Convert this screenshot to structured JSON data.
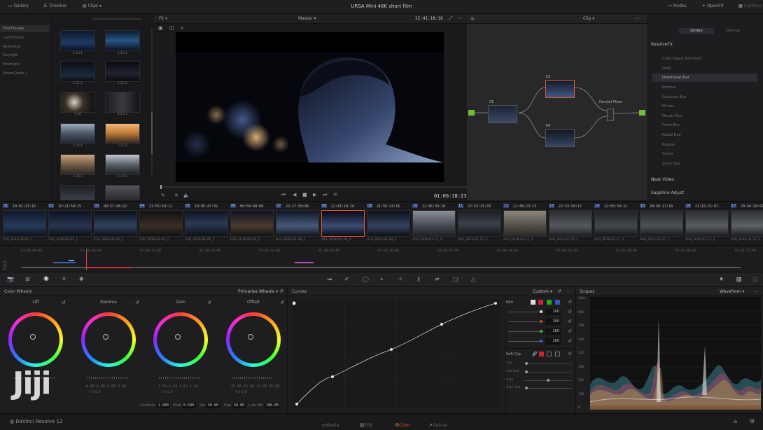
{
  "topbar": {
    "gallery": "Gallery",
    "timeline": "Timeline",
    "clips": "Clips",
    "title": "URSA Mini 46K short film",
    "nodes": "Nodes",
    "openfx": "OpenFX",
    "lightbox": "Lightbox"
  },
  "gallery": {
    "albums": [
      "First Frames",
      "Last Frames",
      "Reference",
      "Daylight",
      "Moonlight",
      "PowerGrade 1"
    ],
    "stills": [
      "1.19.1",
      "1.20.1",
      "1.21.1",
      "1.22.1",
      "1.16",
      "1.23.1",
      "1.24.1",
      "1.25.1",
      "1.26.1",
      "1.27.1",
      "1.28.1",
      "1.29.1"
    ]
  },
  "viewer": {
    "fit": "Fit",
    "mode": "Master",
    "timecode": "22:41:18:16",
    "playhead_tc": "01:00:18:23"
  },
  "nodes": {
    "mode": "Clip",
    "n1": "01",
    "n2": "02",
    "n4": "04",
    "mixer": "Parallel Mixer"
  },
  "library": {
    "tab_library": "Library",
    "tab_settings": "Settings",
    "group1": "ResolveFX",
    "items": [
      "Color Space Transform",
      "Dent",
      "Directional Blur",
      "Emboss",
      "Gaussian Blur",
      "Mirrors",
      "Mosaic Blur",
      "Prism Blur",
      "Radial Blur",
      "Ripples",
      "Vortex",
      "Zoom Blur"
    ],
    "group2": "Neat Video",
    "group3": "Sapphire Adjust"
  },
  "clips": [
    {
      "num": "01",
      "tc": "10:01:23:15",
      "name": "C20_2016-02-05_1"
    },
    {
      "num": "02",
      "tc": "10:21:59:15",
      "name": "C20_2016-02-05_1"
    },
    {
      "num": "03",
      "tc": "09:57:46:22",
      "name": "C20_2016-02-05_1"
    },
    {
      "num": "04",
      "tc": "21:55:54:11",
      "name": "C20_2016-02-05_1"
    },
    {
      "num": "05",
      "tc": "10:05:47:02",
      "name": "C20_2016-02-05_1"
    },
    {
      "num": "06",
      "tc": "09:54:40:08",
      "name": "C20_2016-02-05_1"
    },
    {
      "num": "07",
      "tc": "22:17:56:06",
      "name": "A14_2016-01-28_2"
    },
    {
      "num": "08",
      "tc": "22:41:18:16",
      "name": "A14_2016-01-28_2"
    },
    {
      "num": "09",
      "tc": "21:56:14:16",
      "name": "A14_2016-01-28_2"
    },
    {
      "num": "10",
      "tc": "22:46:34:18",
      "name": "A03_2016-01-27_2"
    },
    {
      "num": "11",
      "tc": "22:53:15:03",
      "name": "A03_2016-01-27_2"
    },
    {
      "num": "12",
      "tc": "22:48:23:13",
      "name": "A03_2016-01-27_2"
    },
    {
      "num": "13",
      "tc": "22:53:58:17",
      "name": "A08_2016-01-27_2"
    },
    {
      "num": "14",
      "tc": "22:56:34:22",
      "name": "A03_2016-01-27_2"
    },
    {
      "num": "15",
      "tc": "20:58:17:18",
      "name": "A08_2016-01-27_2"
    },
    {
      "num": "16",
      "tc": "21:15:21:07",
      "name": "A08_2016-01-27_2"
    },
    {
      "num": "17",
      "tc": "20:44:10:09",
      "name": "A08_2016-01-27_2"
    }
  ],
  "minitimeline": {
    "ticks": [
      "01:00:00:00",
      "01:00:06:00",
      "01:00:12:00",
      "01:00:18:00",
      "01:00:24:00",
      "01:00:30:00",
      "01:00:36:00",
      "01:00:42:00",
      "01:00:48:00",
      "01:00:54:00",
      "01:01:00:00",
      "01:01:06:00",
      "01:01:12:00"
    ]
  },
  "wheels": {
    "title": "Color Wheels",
    "mode": "Primaries Wheels",
    "lift": "Lift",
    "gamma": "Gamma",
    "gain": "Gain",
    "offset": "Offset",
    "lift_vals": "0.00  0.00  0.00  0.00",
    "gamma_vals": "0.00  0.00  0.00  0.00",
    "gain_vals": "1.54  1.54  1.54  1.54",
    "offset_vals": "25.00  25.00  25.00  25.00",
    "contrast_label": "Contrast",
    "contrast": "1.000",
    "pivot_label": "Pivot",
    "pivot": "0.500",
    "sat_label": "Sat",
    "sat": "50.00",
    "hue_label": "Hue",
    "hue": "50.00",
    "lummix_label": "Lum Mix",
    "lummix": "100.00",
    "rgb_letters": "Y   R   G   B"
  },
  "curves": {
    "title": "Curves",
    "mode": "Custom",
    "edit": "Edit",
    "vals": [
      "100",
      "100",
      "100",
      "100"
    ],
    "softclip": "Soft Clip",
    "low": "Low",
    "lowsoft": "Low Soft",
    "high": "High",
    "highsoft": "High Soft"
  },
  "scopes": {
    "title": "Scopes",
    "mode": "Waveform",
    "scale": [
      "1023",
      "896",
      "768",
      "640",
      "512",
      "384",
      "256",
      "128",
      "0"
    ]
  },
  "pages": {
    "app": "DaVinci Resolve 12",
    "media": "Media",
    "edit": "Edit",
    "color": "Color",
    "deliver": "Deliver"
  },
  "watermark": "Jiji"
}
